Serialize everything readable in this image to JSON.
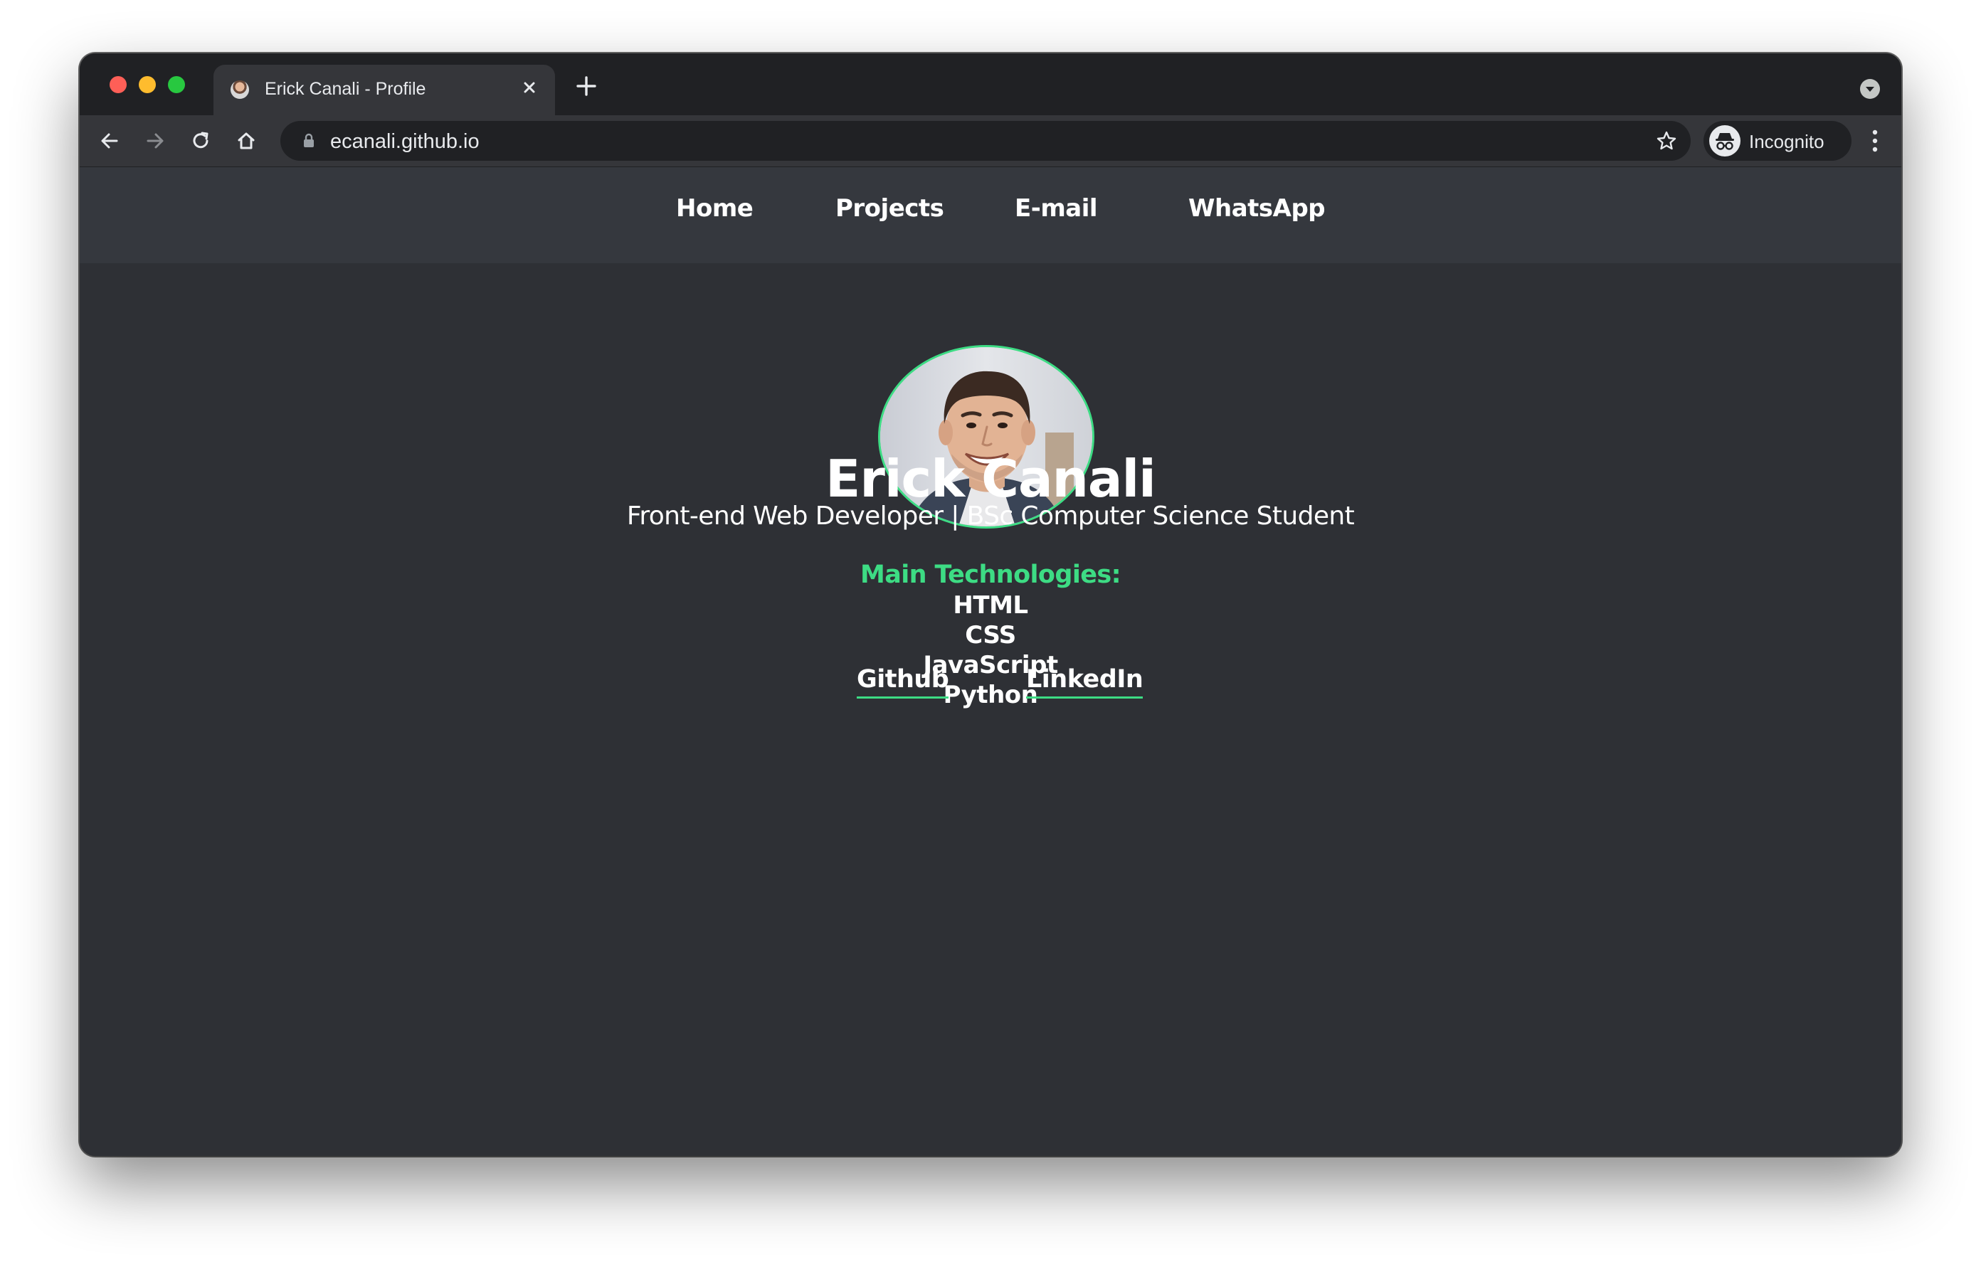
{
  "browser": {
    "tab": {
      "title": "Erick Canali - Profile"
    },
    "address_bar": {
      "url": "ecanali.github.io"
    },
    "profile": {
      "label": "Incognito"
    },
    "icons": {
      "back": "back-arrow-icon",
      "forward": "forward-arrow-icon",
      "reload": "reload-icon",
      "home": "home-icon",
      "lock": "lock-icon",
      "bookmark": "star-icon",
      "incognito": "incognito-icon",
      "menu": "kebab-menu-icon",
      "close_tab": "close-icon",
      "new_tab": "plus-icon",
      "tab_search": "chevron-down-icon"
    }
  },
  "site": {
    "nav": {
      "items": [
        {
          "label": "Home"
        },
        {
          "label": "Projects"
        },
        {
          "label": "E-mail"
        },
        {
          "label": "WhatsApp"
        }
      ]
    },
    "profile": {
      "name": "Erick Canali",
      "tagline": "Front-end Web Developer | BSc Computer Science Student"
    },
    "technologies": {
      "heading": "Main Technologies:",
      "items": [
        "HTML",
        "CSS",
        "JavaScript",
        "Python"
      ]
    },
    "social": {
      "github": "Github",
      "linkedin": "LinkedIn"
    }
  },
  "colors": {
    "accent": "#3ddc84",
    "page_background": "#2e3035",
    "nav_background": "#35383e",
    "text": "#ffffff"
  }
}
